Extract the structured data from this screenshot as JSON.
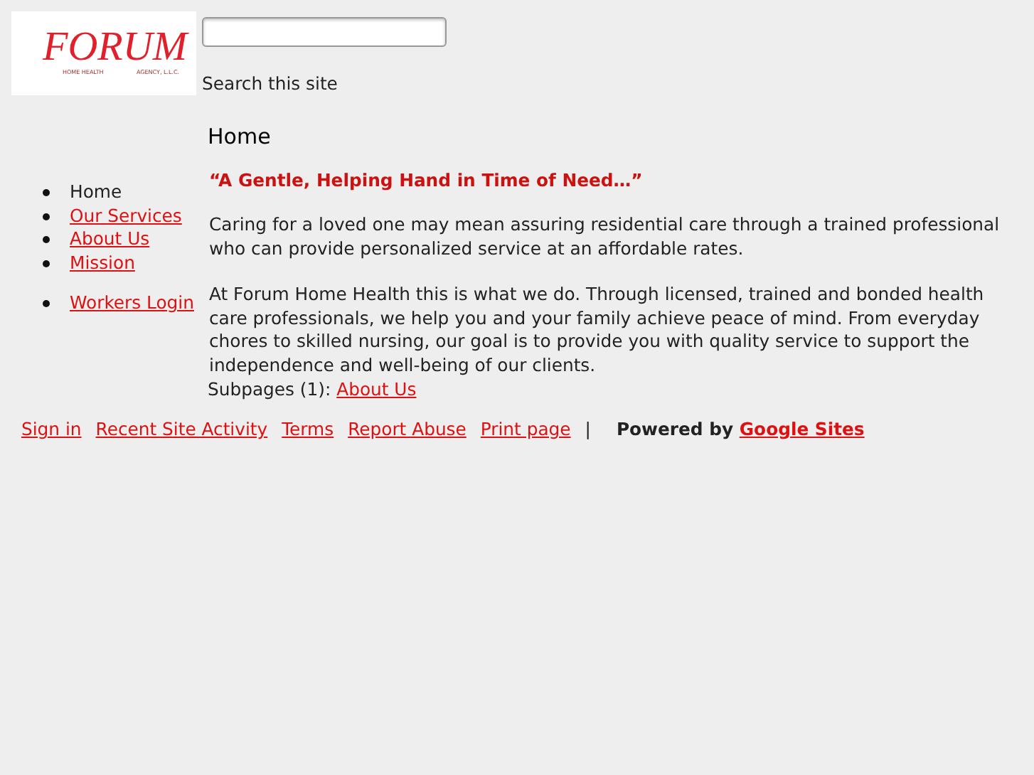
{
  "logo": {
    "name": "FORUM",
    "tagline_left": "HOME HEALTH",
    "tagline_right": "AGENCY, L.L.C."
  },
  "search": {
    "label": "Search this site"
  },
  "page_title": "Home",
  "nav": [
    [
      {
        "label": "Home",
        "selected": true
      },
      {
        "label": "Our Services",
        "selected": false
      },
      {
        "label": "About Us",
        "selected": false
      },
      {
        "label": "Mission",
        "selected": false
      }
    ],
    [
      {
        "label": "Workers Login",
        "selected": false
      }
    ]
  ],
  "headline": "“A Gentle, Helping Hand in Time of Need…”",
  "paragraphs": [
    "Caring for a loved one may mean assuring residential care through a trained professional who can provide personalized service at an affordable rates.",
    "At Forum Home Health this is what we do.  Through licensed, trained and bonded health care professionals, we help you and your family achieve peace of mind.  From everyday chores to skilled nursing, our goal is to provide you with quality service to support the independence and well-being of our clients."
  ],
  "subpages": {
    "label": "Subpages (1):",
    "link": "About Us"
  },
  "footer": {
    "links": [
      "Sign in",
      "Recent Site Activity",
      "Terms",
      "Report Abuse",
      "Print page"
    ],
    "separator": "|",
    "powered_by": "Powered by",
    "powered_link": "Google Sites"
  }
}
